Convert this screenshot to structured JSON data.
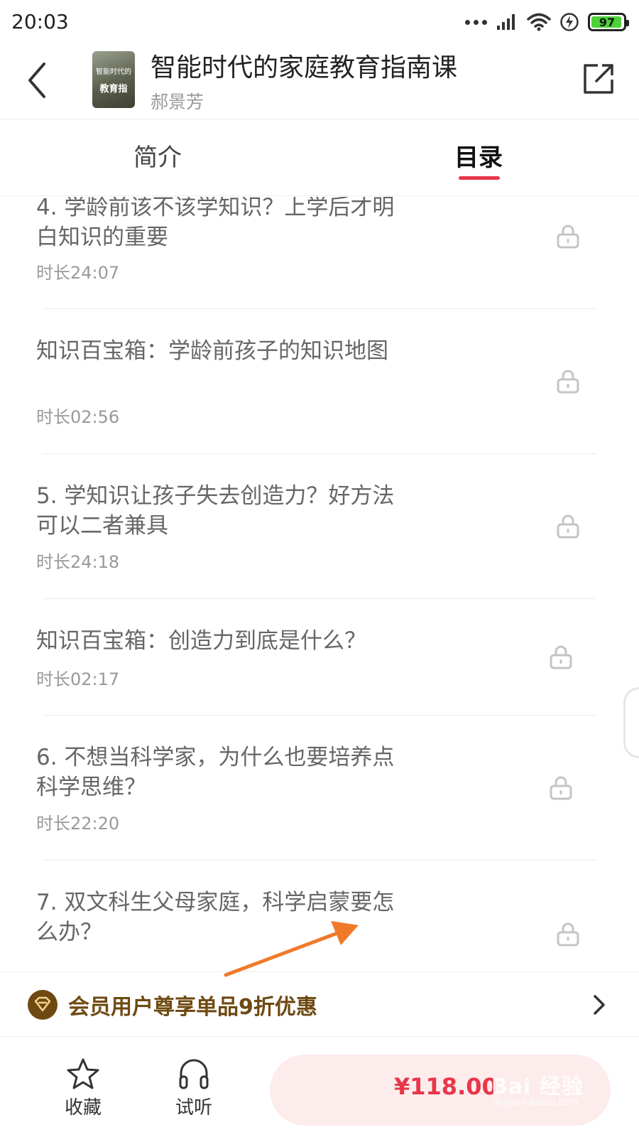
{
  "status_bar": {
    "time": "20:03",
    "battery": "97",
    "icons": [
      "dots-icon",
      "signal-icon",
      "wifi-icon",
      "charging-icon",
      "battery-icon"
    ]
  },
  "header": {
    "course_title": "智能时代的家庭教育指南课",
    "author": "郝景芳",
    "cover_line1": "智能时代的",
    "cover_line2": "教育指"
  },
  "tabs": {
    "intro": "简介",
    "catalog": "目录",
    "active": "catalog"
  },
  "lessons": [
    {
      "title": "4. 学龄前该不该学知识？上学后才明白知识的重要",
      "duration": "时长24:07",
      "locked": true
    },
    {
      "title": "知识百宝箱：学龄前孩子的知识地图",
      "duration": "时长02:56",
      "locked": true
    },
    {
      "title": "5. 学知识让孩子失去创造力？好方法可以二者兼具",
      "duration": "时长24:18",
      "locked": true
    },
    {
      "title": "知识百宝箱：创造力到底是什么？",
      "duration": "时长02:17",
      "locked": true
    },
    {
      "title": "6. 不想当科学家，为什么也要培养点科学思维？",
      "duration": "时长22:20",
      "locked": true
    },
    {
      "title": "7. 双文科生父母家庭，科学启蒙要怎么办？",
      "locked": true
    }
  ],
  "member_bar": {
    "text": "会员用户尊享单品9折优惠"
  },
  "bottom_bar": {
    "favorite_label": "收藏",
    "listen_label": "试听",
    "price": "¥118.00"
  },
  "watermark": {
    "text": "Bai 经验",
    "sub": "jingyan.baidu.com"
  },
  "colors": {
    "accent": "#e8364a",
    "member_text": "#6e4a12",
    "buy_bg": "#fdecec",
    "annotation_arrow": "#f07a2a"
  }
}
